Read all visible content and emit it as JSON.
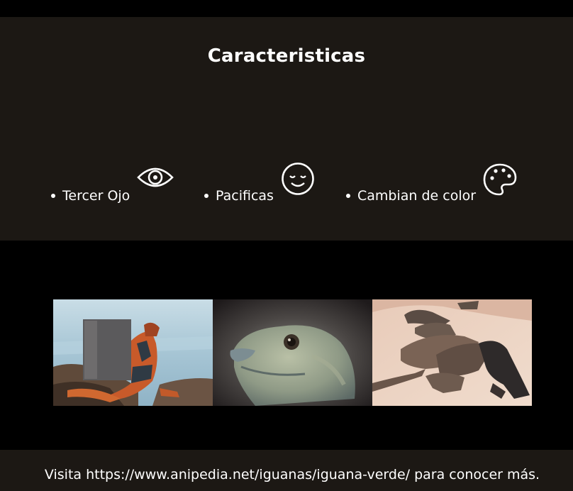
{
  "features": {
    "title": "Caracteristicas",
    "items": [
      {
        "label": "Tercer Ojo",
        "icon": "eye-icon"
      },
      {
        "label": "Pacificas",
        "icon": "smiling-face-icon"
      },
      {
        "label": "Cambian de color",
        "icon": "palette-icon"
      }
    ]
  },
  "gallery": {
    "photos": [
      "iguana-on-rocks-photo",
      "iguana-head-closeup-photo",
      "iguanas-group-on-sand-photo"
    ]
  },
  "footer": {
    "text": "Visita https://www.anipedia.net/iguanas/iguana-verde/ para conocer más."
  },
  "colors": {
    "panel": "#1c1814",
    "background": "#000000",
    "text": "#ffffff"
  }
}
